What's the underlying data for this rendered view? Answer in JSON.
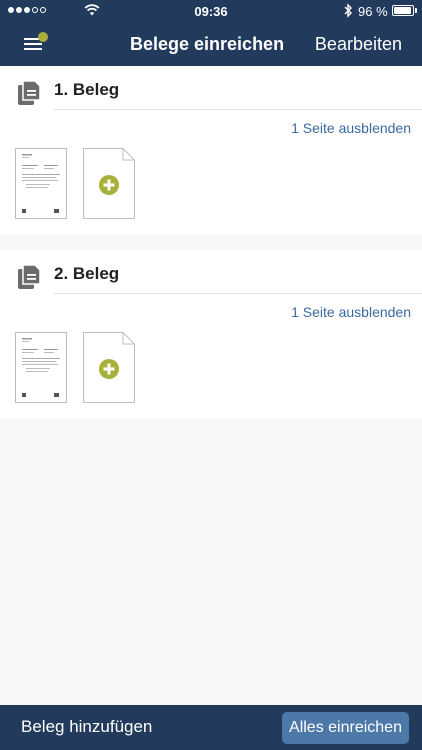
{
  "status_bar": {
    "time": "09:36",
    "battery_text": "96 %",
    "battery_level": 0.96,
    "signal_bars_filled": 3,
    "signal_bars_total": 5
  },
  "nav": {
    "title": "Belege einreichen",
    "edit_label": "Bearbeiten",
    "menu_badge_color": "#a8b03a"
  },
  "receipts": [
    {
      "title": "1. Beleg",
      "toggle_label": "1 Seite ausblenden"
    },
    {
      "title": "2. Beleg",
      "toggle_label": "1 Seite ausblenden"
    }
  ],
  "bottom_bar": {
    "add_label": "Beleg hinzufügen",
    "submit_label": "Alles einreichen"
  },
  "colors": {
    "primary": "#223a5c",
    "accent": "#a8b03a",
    "link": "#3c6aa0",
    "button": "#4d79a8"
  },
  "icons": {
    "menu": "hamburger-icon",
    "document": "documents-icon",
    "add": "plus-circle-icon",
    "wifi": "wifi-icon",
    "bluetooth": "bluetooth-icon",
    "battery": "battery-icon"
  }
}
